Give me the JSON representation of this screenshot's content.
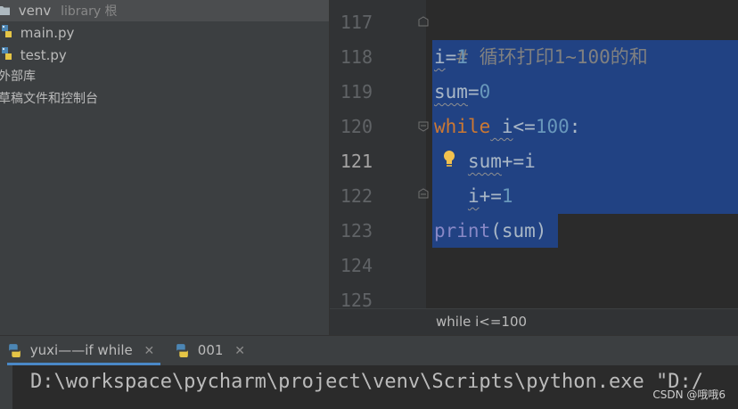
{
  "project_tree": {
    "venv_name": "venv",
    "venv_meta": "library 根",
    "files": [
      "main.py",
      "test.py"
    ],
    "external_libraries": "外部库",
    "scratches": "草稿文件和控制台"
  },
  "editor": {
    "line_numbers": [
      "117",
      "118",
      "119",
      "120",
      "121",
      "122",
      "123",
      "124",
      "125"
    ],
    "current_line": "121",
    "lines": {
      "l117_comment": "# 循环打印1~100的和",
      "l118_var": "i",
      "l118_op": "=",
      "l118_num": "1",
      "l119_var": "sum",
      "l119_op": "=",
      "l119_num": "0",
      "l120_kw": "while",
      "l120_var": " i",
      "l120_op": "<=",
      "l120_num": "100",
      "l120_colon": ":",
      "l121_indent": "   ",
      "l121_var": "sum",
      "l121_op": "+=",
      "l121_var2": "i",
      "l122_indent": "   ",
      "l122_var": "i",
      "l122_op": "+=",
      "l122_num": "1",
      "l123_fn": "print",
      "l123_args": "(sum)"
    },
    "intention_icon": "lightbulb-icon"
  },
  "breadcrumb": "while i<=100",
  "run_tabs": [
    {
      "label": "yuxi——if  while",
      "icon": "python-icon",
      "close": "✕"
    },
    {
      "label": "001",
      "icon": "python-icon",
      "close": "✕"
    }
  ],
  "console_text": "D:\\workspace\\pycharm\\project\\venv\\Scripts\\python.exe \"D:/",
  "watermark": "CSDN @哦哦6",
  "colors": {
    "selection": "#214283",
    "keyword": "#cc7832",
    "number": "#6897bb",
    "builtin": "#8888c6",
    "comment": "#808080",
    "active_tab_underline": "#4a88c7"
  }
}
